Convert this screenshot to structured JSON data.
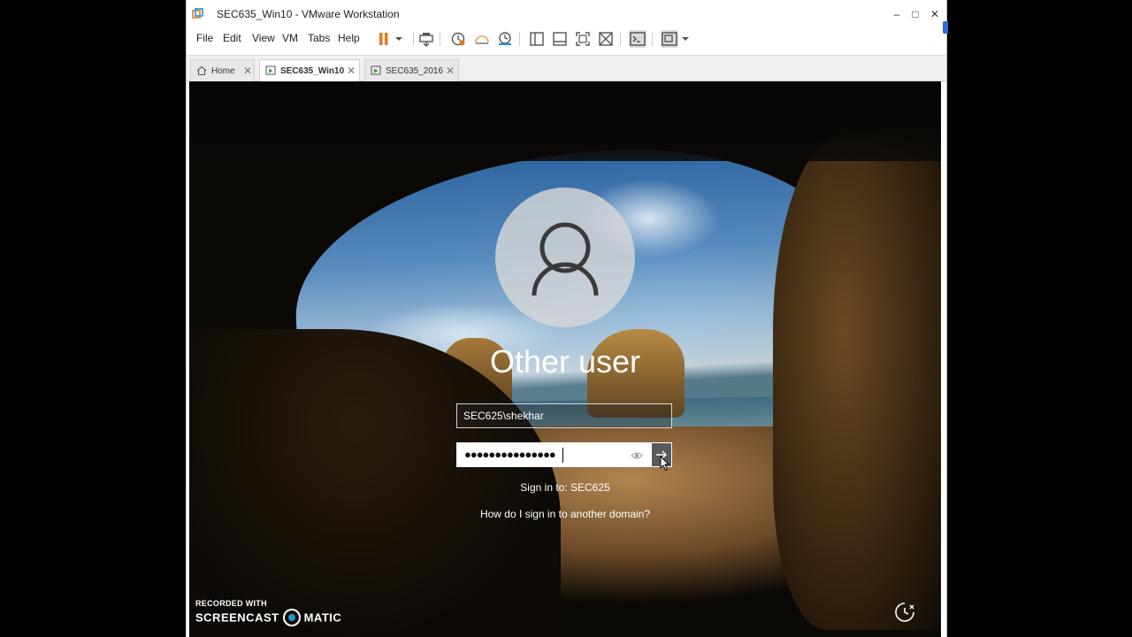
{
  "window": {
    "title": "SEC635_Win10 - VMware Workstation",
    "controls": {
      "minimize": "–",
      "maximize": "□",
      "close": "✕"
    }
  },
  "menu": {
    "items": [
      "File",
      "Edit",
      "View",
      "VM",
      "Tabs",
      "Help"
    ]
  },
  "toolbar": {
    "icons": [
      "pause-icon",
      "dropdown-icon",
      "send-ctrl-alt-del-icon",
      "snapshot-icon",
      "revert-snapshot-icon",
      "snapshot-manager-icon",
      "show-library-icon",
      "thumbnail-bar-icon",
      "full-screen-icon",
      "unity-icon",
      "console-view-icon",
      "stretch-guest-icon"
    ]
  },
  "tabs": [
    {
      "label": "Home",
      "active": false
    },
    {
      "label": "SEC635_Win10",
      "active": true
    },
    {
      "label": "SEC635_2016",
      "active": false
    }
  ],
  "login": {
    "user_name": "Other user",
    "username_value": "SEC625\\shekhar",
    "password_mask": "●●●●●●●●●●●●●●●",
    "sign_in_to": "Sign in to: SEC625",
    "help_link": "How do I sign in to another domain?"
  },
  "watermark": {
    "line1": "RECORDED WITH",
    "left": "SCREENCAST",
    "right": "MATIC"
  },
  "colors": {
    "pause": "#e8771b",
    "accent": "#2b8fd6"
  }
}
